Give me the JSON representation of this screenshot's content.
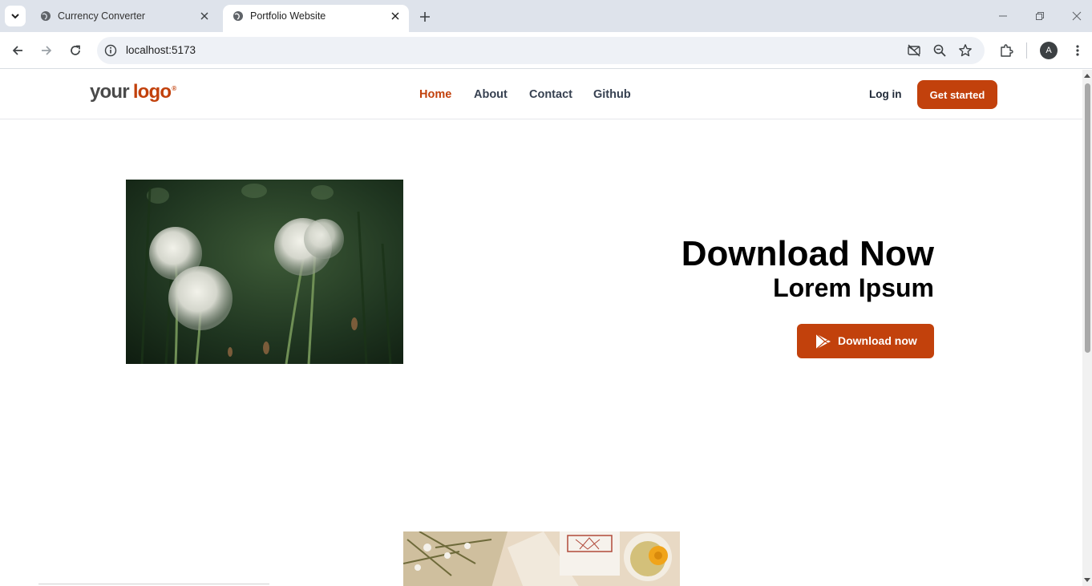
{
  "browser": {
    "tabs": [
      {
        "title": "Currency Converter",
        "active": false
      },
      {
        "title": "Portfolio Website",
        "active": true
      }
    ],
    "url": "localhost:5173",
    "profile_initial": "A"
  },
  "site": {
    "logo": {
      "part1": "your",
      "part2": "logo",
      "mark": "®"
    },
    "nav": [
      "Home",
      "About",
      "Contact",
      "Github"
    ],
    "active_nav": "Home",
    "login_label": "Log in",
    "cta_label": "Get started"
  },
  "hero": {
    "title": "Download Now",
    "subtitle": "Lorem Ipsum",
    "button_label": "Download now",
    "button_icon": "play-store-icon",
    "image": "dandelions-photo"
  },
  "colors": {
    "accent": "#c2410c",
    "text": "#000000",
    "nav_text": "#374151",
    "chrome_bg": "#dee3eb"
  }
}
